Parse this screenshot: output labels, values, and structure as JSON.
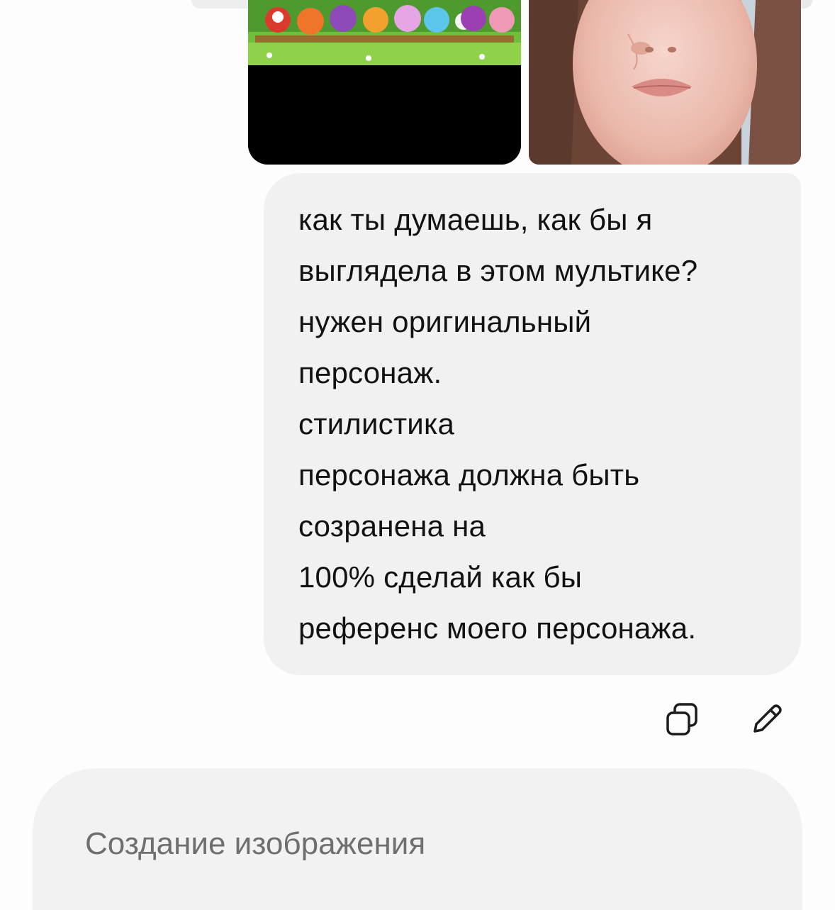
{
  "attachments": [
    {
      "kind": "cartoon-still",
      "name": "cartoon-image"
    },
    {
      "kind": "portrait-photo",
      "name": "selfie-photo"
    }
  ],
  "message": {
    "lines": [
      "как ты думаешь, как бы я",
      "выглядела в этом мультике?",
      "нужен оригинальный",
      "персонаж.",
      "стилистика",
      "персонажа должна быть",
      "созранена на",
      "100% сделай как бы",
      "референс моего персонажа."
    ],
    "bubble_color": "#f1f1f1"
  },
  "actions": {
    "copy_icon": "copy-icon",
    "edit_icon": "pencil-icon"
  },
  "composer": {
    "label": "Создание изображения"
  }
}
